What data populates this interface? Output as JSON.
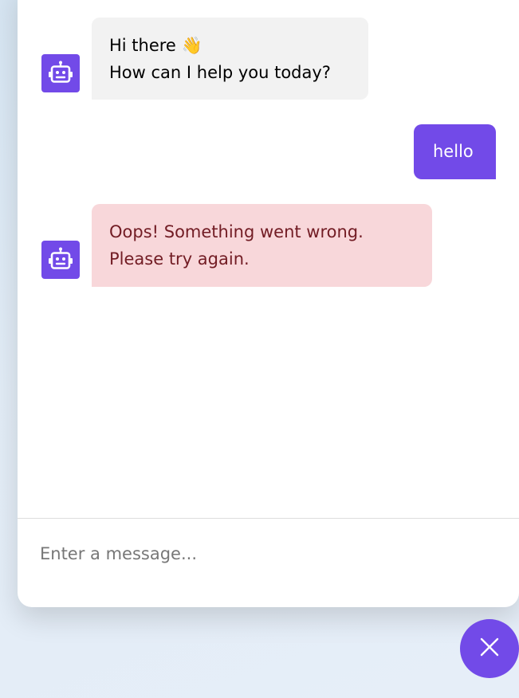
{
  "theme": {
    "accent": "#724ae8",
    "incoming_bubble": "#f2f2f2",
    "error_bubble": "#f8d7da",
    "error_text": "#721c24"
  },
  "messages": [
    {
      "role": "bot",
      "type": "incoming",
      "text": "Hi there 👋\nHow can I help you today?",
      "avatar_icon": "robot-icon"
    },
    {
      "role": "user",
      "type": "outgoing",
      "text": "hello"
    },
    {
      "role": "bot",
      "type": "error",
      "text": "Oops! Something went wrong.\nPlease try again.",
      "avatar_icon": "robot-icon"
    }
  ],
  "input": {
    "placeholder": "Enter a message...",
    "value": ""
  },
  "toggler": {
    "icon": "close-icon"
  }
}
